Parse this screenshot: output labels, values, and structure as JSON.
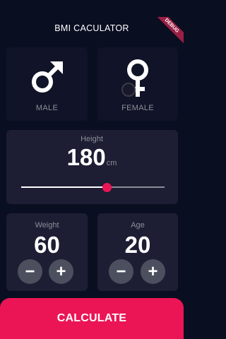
{
  "app": {
    "title": "BMI CACULATOR",
    "debug_banner": "DEBUG"
  },
  "gender": {
    "male": {
      "label": "MALE",
      "icon": "mars-icon",
      "selected": false
    },
    "female": {
      "label": "FEMALE",
      "icon": "venus-icon",
      "selected": false
    }
  },
  "height": {
    "label": "Height",
    "value": "180",
    "unit": "cm",
    "slider_fraction": 0.6
  },
  "weight": {
    "label": "Weight",
    "value": "60",
    "minus": "−",
    "plus": "+"
  },
  "age": {
    "label": "Age",
    "value": "20",
    "minus": "−",
    "plus": "+"
  },
  "calculate": {
    "label": "CALCULATE"
  },
  "colors": {
    "background": "#0a0e21",
    "card": "#1d1e33",
    "card_inactive": "#111328",
    "accent": "#eb1555",
    "muted_text": "#8d8e98",
    "round_button": "#4c4f5e"
  }
}
